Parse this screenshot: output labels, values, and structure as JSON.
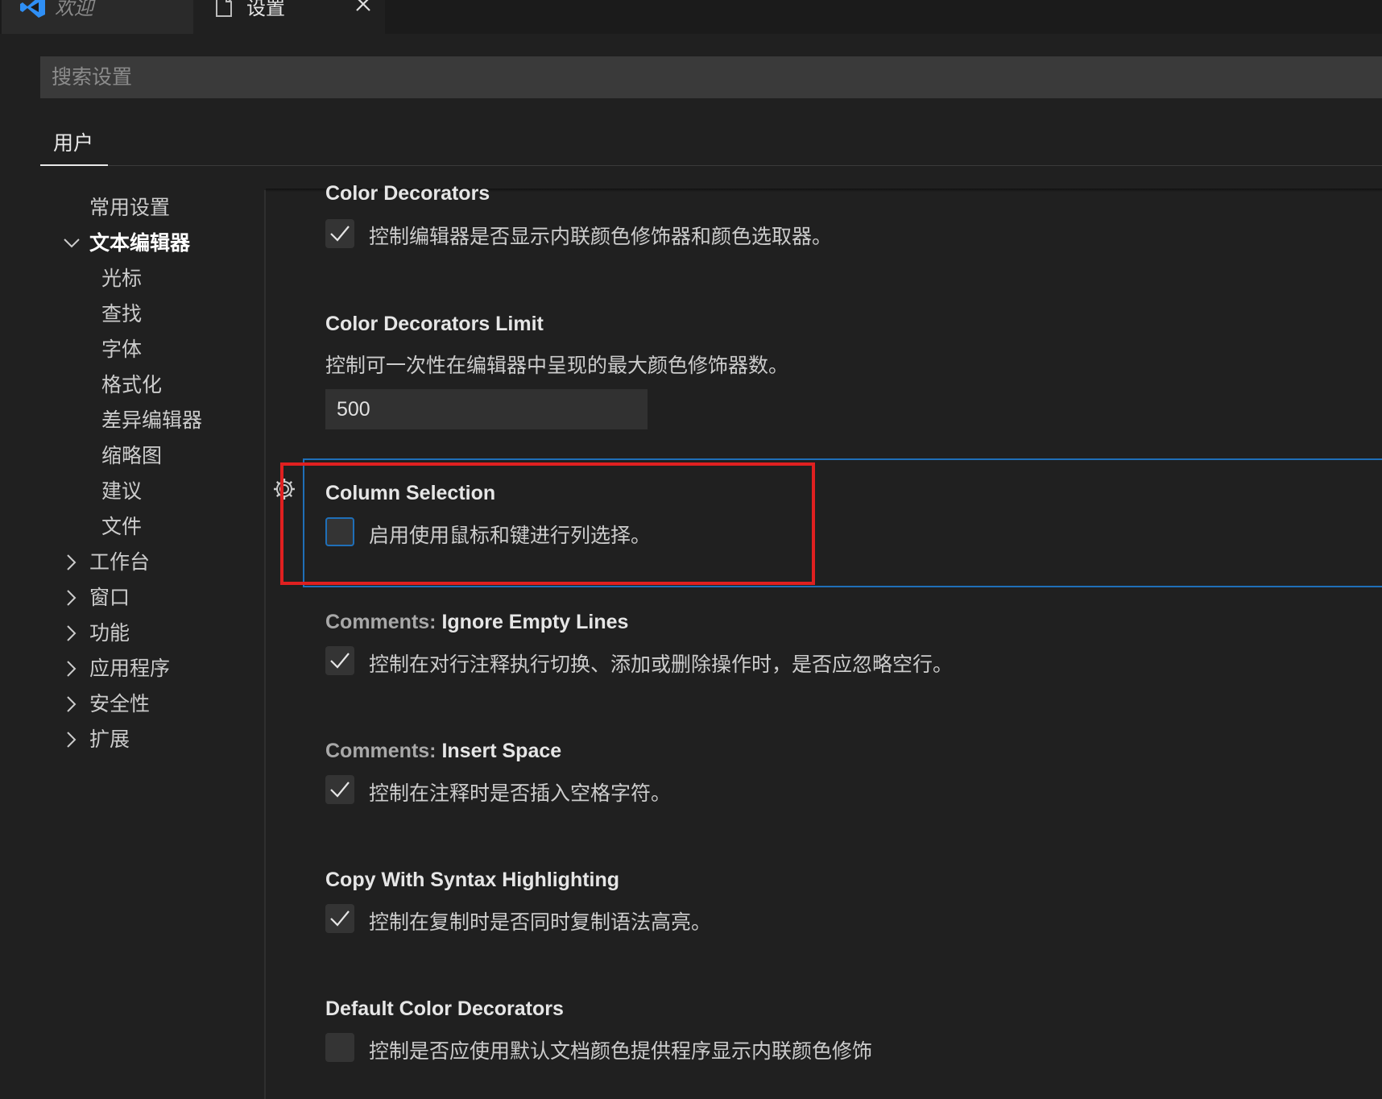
{
  "tabs": [
    {
      "label": "欢迎",
      "icon": "vscode-logo-icon"
    },
    {
      "label": "设置",
      "icon": "file-icon"
    }
  ],
  "search": {
    "placeholder": "搜索设置"
  },
  "scope": {
    "user_tab": "用户"
  },
  "nav": {
    "common": "常用设置",
    "text_editor": "文本编辑器",
    "children": [
      "光标",
      "查找",
      "字体",
      "格式化",
      "差异编辑器",
      "缩略图",
      "建议",
      "文件"
    ],
    "collapsed": [
      "工作台",
      "窗口",
      "功能",
      "应用程序",
      "安全性",
      "扩展"
    ]
  },
  "settings": {
    "color_decorators": {
      "title": "Color Decorators",
      "desc": "控制编辑器是否显示内联颜色修饰器和颜色选取器。",
      "checked": true
    },
    "color_decorators_limit": {
      "title": "Color Decorators Limit",
      "desc": "控制可一次性在编辑器中呈现的最大颜色修饰器数。",
      "value": "500"
    },
    "column_selection": {
      "title": "Column Selection",
      "desc": "启用使用鼠标和键进行列选择。",
      "checked": false
    },
    "comments_ignore_empty": {
      "category": "Comments: ",
      "title": "Ignore Empty Lines",
      "desc": "控制在对行注释执行切换、添加或删除操作时，是否应忽略空行。",
      "checked": true
    },
    "comments_insert_space": {
      "category": "Comments: ",
      "title": "Insert Space",
      "desc": "控制在注释时是否插入空格字符。",
      "checked": true
    },
    "copy_syntax": {
      "title": "Copy With Syntax Highlighting",
      "desc": "控制在复制时是否同时复制语法高亮。",
      "checked": true
    },
    "default_color_decorators": {
      "title": "Default Color Decorators",
      "desc": "控制是否应使用默认文档颜色提供程序显示内联颜色修饰",
      "checked": false
    }
  },
  "colors": {
    "accent_focus": "#1f6fb8",
    "annotation_red": "#e02020",
    "vscode_blue": "#2f8ff5"
  }
}
